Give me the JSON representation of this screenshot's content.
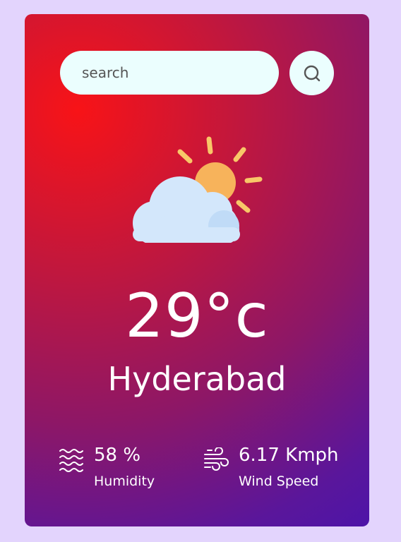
{
  "search": {
    "placeholder": "search",
    "value": ""
  },
  "weather": {
    "condition_icon": "partly-cloudy-icon",
    "temperature": "29°c",
    "city": "Hyderabad"
  },
  "stats": {
    "humidity": {
      "icon": "humidity-waves-icon",
      "value": "58 %",
      "label": "Humidity"
    },
    "wind": {
      "icon": "wind-icon",
      "value": "6.17 Kmph",
      "label": "Wind Speed"
    }
  },
  "colors": {
    "page_background": "#e3d4fd",
    "gradient_start": "#f81317",
    "gradient_end": "#4d14a8",
    "input_background": "#ebfefe",
    "text": "#ffffff"
  }
}
